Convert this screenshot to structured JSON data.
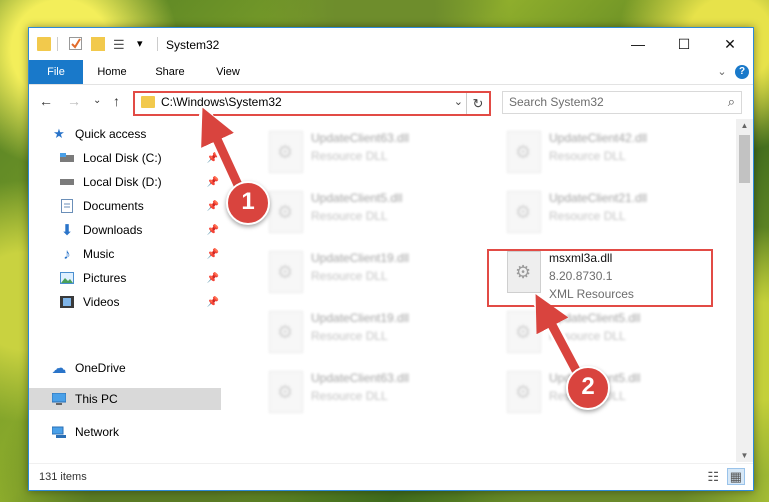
{
  "window": {
    "title": "System32",
    "controls": {
      "minimize": "—",
      "maximize": "☐",
      "close": "✕"
    }
  },
  "ribbon": {
    "tabs": [
      "File",
      "Home",
      "Share",
      "View"
    ],
    "collapse": "⌄",
    "help": "?"
  },
  "address": {
    "path": "C:\\Windows\\System32",
    "search_placeholder": "Search System32"
  },
  "nav": {
    "back": "←",
    "forward": "→",
    "recent": "⌄",
    "up": "↑"
  },
  "sidebar": {
    "items": [
      {
        "label": "Quick access",
        "icon": "star-icon"
      },
      {
        "label": "Local Disk (C:)",
        "icon": "drive-icon",
        "pinned": true
      },
      {
        "label": "Local Disk (D:)",
        "icon": "drive-icon",
        "pinned": true
      },
      {
        "label": "Documents",
        "icon": "documents-icon",
        "pinned": true
      },
      {
        "label": "Downloads",
        "icon": "downloads-icon",
        "pinned": true
      },
      {
        "label": "Music",
        "icon": "music-icon",
        "pinned": true
      },
      {
        "label": "Pictures",
        "icon": "pictures-icon",
        "pinned": true
      },
      {
        "label": "Videos",
        "icon": "videos-icon",
        "pinned": true
      },
      {
        "label": "OneDrive",
        "icon": "cloud-icon"
      },
      {
        "label": "This PC",
        "icon": "pc-icon",
        "selected": true
      },
      {
        "label": "Network",
        "icon": "network-icon"
      }
    ]
  },
  "files": [
    {
      "name": "UpdateClient63.dll",
      "desc": "Resource DLL"
    },
    {
      "name": "UpdateClient42.dll",
      "desc": "Resource DLL"
    },
    {
      "name": "UpdateClient5.dll",
      "desc": "Resource DLL"
    },
    {
      "name": "UpdateClient21.dll",
      "desc": "Resource DLL"
    },
    {
      "name": "UpdateClient19.dll",
      "desc": "Resource DLL"
    },
    {
      "name": "msxml3a.dll",
      "version": "8.20.8730.1",
      "desc": "XML Resources"
    },
    {
      "name": "UpdateClient19.dll",
      "desc": "Resource DLL"
    },
    {
      "name": "UpdateClient5.dll",
      "desc": "Resource DLL"
    },
    {
      "name": "UpdateClient63.dll",
      "desc": "Resource DLL"
    },
    {
      "name": "UpdateClient5.dll",
      "desc": "Resource DLL"
    }
  ],
  "status": {
    "count": "131 items"
  },
  "annotations": {
    "step1": "1",
    "step2": "2"
  },
  "colors": {
    "accent": "#1979ca",
    "highlight": "#e24b45"
  }
}
